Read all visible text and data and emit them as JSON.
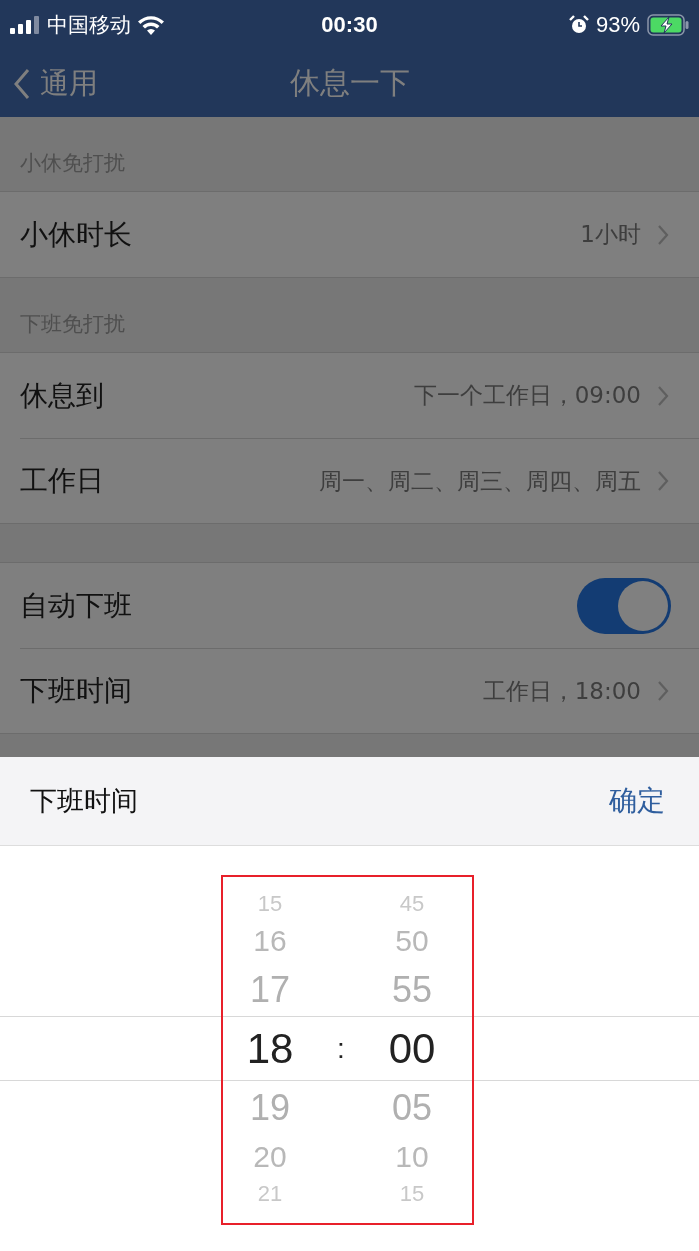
{
  "status_bar": {
    "carrier": "中国移动",
    "time": "00:30",
    "battery": "93%"
  },
  "nav": {
    "back": "通用",
    "title": "休息一下"
  },
  "sections": [
    {
      "header": "小休免打扰",
      "rows": [
        {
          "kind": "value",
          "label": "小休时长",
          "value": "1小时"
        }
      ]
    },
    {
      "header": "下班免打扰",
      "rows": [
        {
          "kind": "value",
          "label": "休息到",
          "value": "下一个工作日，09:00"
        },
        {
          "kind": "value",
          "label": "工作日",
          "value": "周一、周二、周三、周四、周五"
        }
      ]
    },
    {
      "rows": [
        {
          "kind": "toggle",
          "label": "自动下班",
          "on": true
        },
        {
          "kind": "value",
          "label": "下班时间",
          "value": "工作日，18:00"
        }
      ]
    }
  ],
  "sheet": {
    "title": "下班时间",
    "confirm": "确定",
    "separator": ":",
    "hours": [
      {
        "text": "15",
        "selected": false
      },
      {
        "text": "16",
        "selected": false
      },
      {
        "text": "17",
        "selected": false
      },
      {
        "text": "18",
        "selected": true
      },
      {
        "text": "19",
        "selected": false
      },
      {
        "text": "20",
        "selected": false
      },
      {
        "text": "21",
        "selected": false
      }
    ],
    "minutes": [
      {
        "text": "45",
        "selected": false
      },
      {
        "text": "50",
        "selected": false
      },
      {
        "text": "55",
        "selected": false
      },
      {
        "text": "00",
        "selected": true
      },
      {
        "text": "05",
        "selected": false
      },
      {
        "text": "10",
        "selected": false
      },
      {
        "text": "15",
        "selected": false
      }
    ]
  }
}
